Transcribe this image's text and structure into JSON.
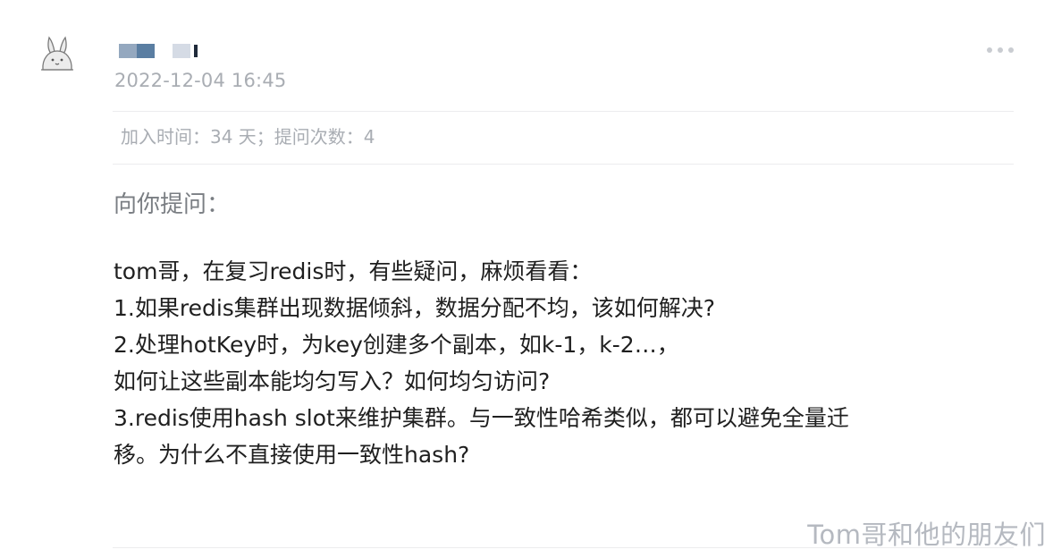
{
  "post": {
    "timestamp": "2022-12-04 16:45",
    "meta": "加入时间：34 天；提问次数：4",
    "ask_title": "向你提问：",
    "question_lines": [
      "tom哥，在复习redis时，有些疑问，麻烦看看：",
      "1.如果redis集群出现数据倾斜，数据分配不均，该如何解决?",
      "2.处理hotKey时，为key创建多个副本，如k-1，k-2…，",
      "如何让这些副本能均匀写入？如何均匀访问?",
      "3.redis使用hash slot来维护集群。与一致性哈希类似，都可以避免全量迁",
      "移。为什么不直接使用一致性hash?"
    ]
  },
  "icons": {
    "avatar": "bunny-avatar-icon",
    "more": "more-dots-icon"
  },
  "watermark": "Tom哥和他的朋友们",
  "colors": {
    "muted_text": "#a9adb3",
    "body_text": "#1f1f1f",
    "divider": "#ececee"
  }
}
